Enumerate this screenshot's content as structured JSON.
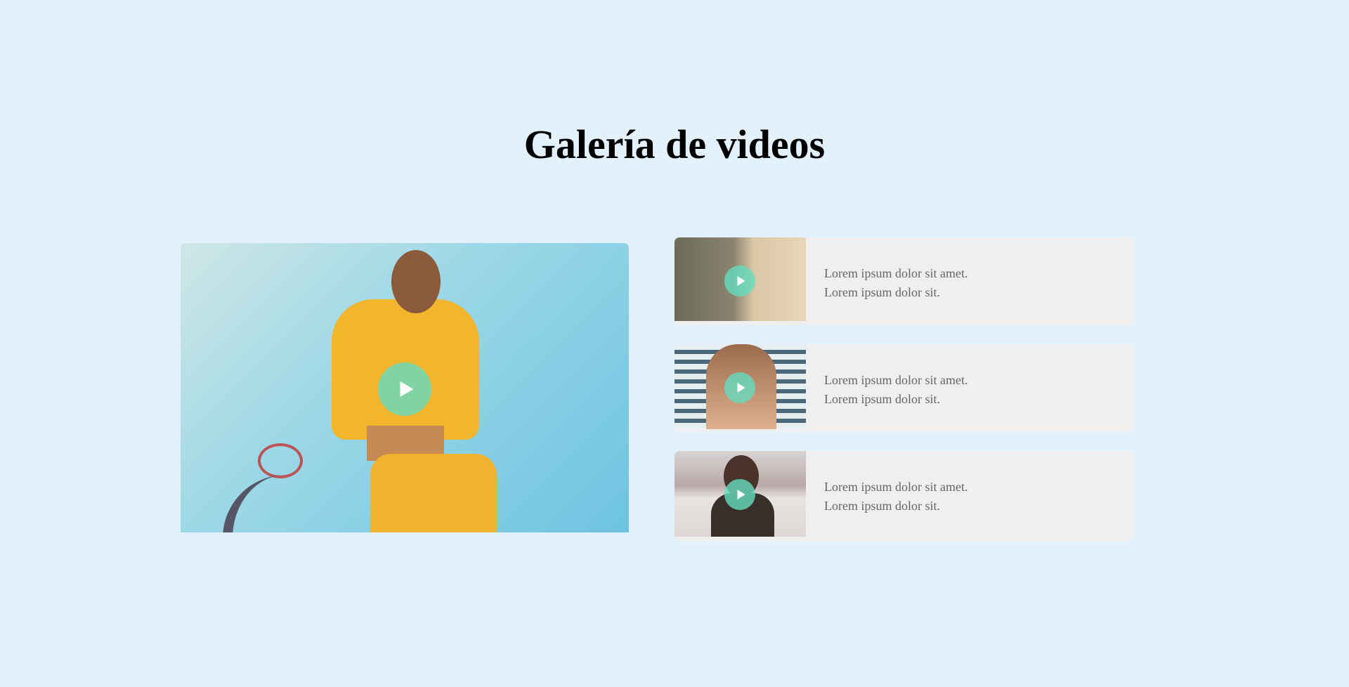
{
  "page_title": "Galería de videos",
  "accent_color": "#64dcbe",
  "main_video": {
    "play_icon": "play-icon"
  },
  "videos": [
    {
      "line1": "Lorem ipsum dolor sit amet.",
      "line2": "Lorem ipsum dolor sit."
    },
    {
      "line1": "Lorem ipsum dolor sit amet.",
      "line2": "Lorem ipsum dolor sit."
    },
    {
      "line1": "Lorem ipsum dolor sit amet.",
      "line2": "Lorem ipsum dolor sit."
    }
  ]
}
